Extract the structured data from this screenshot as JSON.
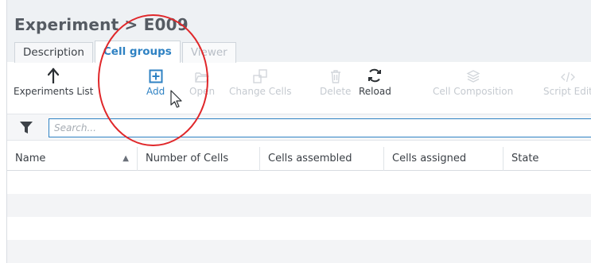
{
  "header": {
    "title": "Experiment > E009"
  },
  "tabs": [
    {
      "label": "Description",
      "state": "normal"
    },
    {
      "label": "Cell groups",
      "state": "active"
    },
    {
      "label": "Viewer",
      "state": "disabled"
    }
  ],
  "toolbar": {
    "experiments_list": {
      "label": "Experiments List",
      "icon": "arrow-up-icon"
    },
    "add": {
      "label": "Add",
      "icon": "plus-box-icon"
    },
    "open": {
      "label": "Open",
      "icon": "folder-open-icon"
    },
    "change_cells": {
      "label": "Change Cells",
      "icon": "cells-icon"
    },
    "delete": {
      "label": "Delete",
      "icon": "trash-icon"
    },
    "reload": {
      "label": "Reload",
      "icon": "refresh-icon"
    },
    "cell_composition": {
      "label": "Cell Composition",
      "icon": "layers-icon"
    },
    "script_editor": {
      "label": "Script Edit",
      "icon": "code-icon"
    }
  },
  "search": {
    "placeholder": "Search..."
  },
  "grid": {
    "columns": [
      "Name",
      "Number of Cells",
      "Cells assembled",
      "Cells assigned",
      "State"
    ],
    "sort_column": "Name",
    "sort_direction": "ascending",
    "rows": []
  },
  "colors": {
    "accent": "#2f82c3",
    "annotation": "#e0272a",
    "disabled_text": "#c5cad0",
    "header_bg": "#eef1f4"
  }
}
